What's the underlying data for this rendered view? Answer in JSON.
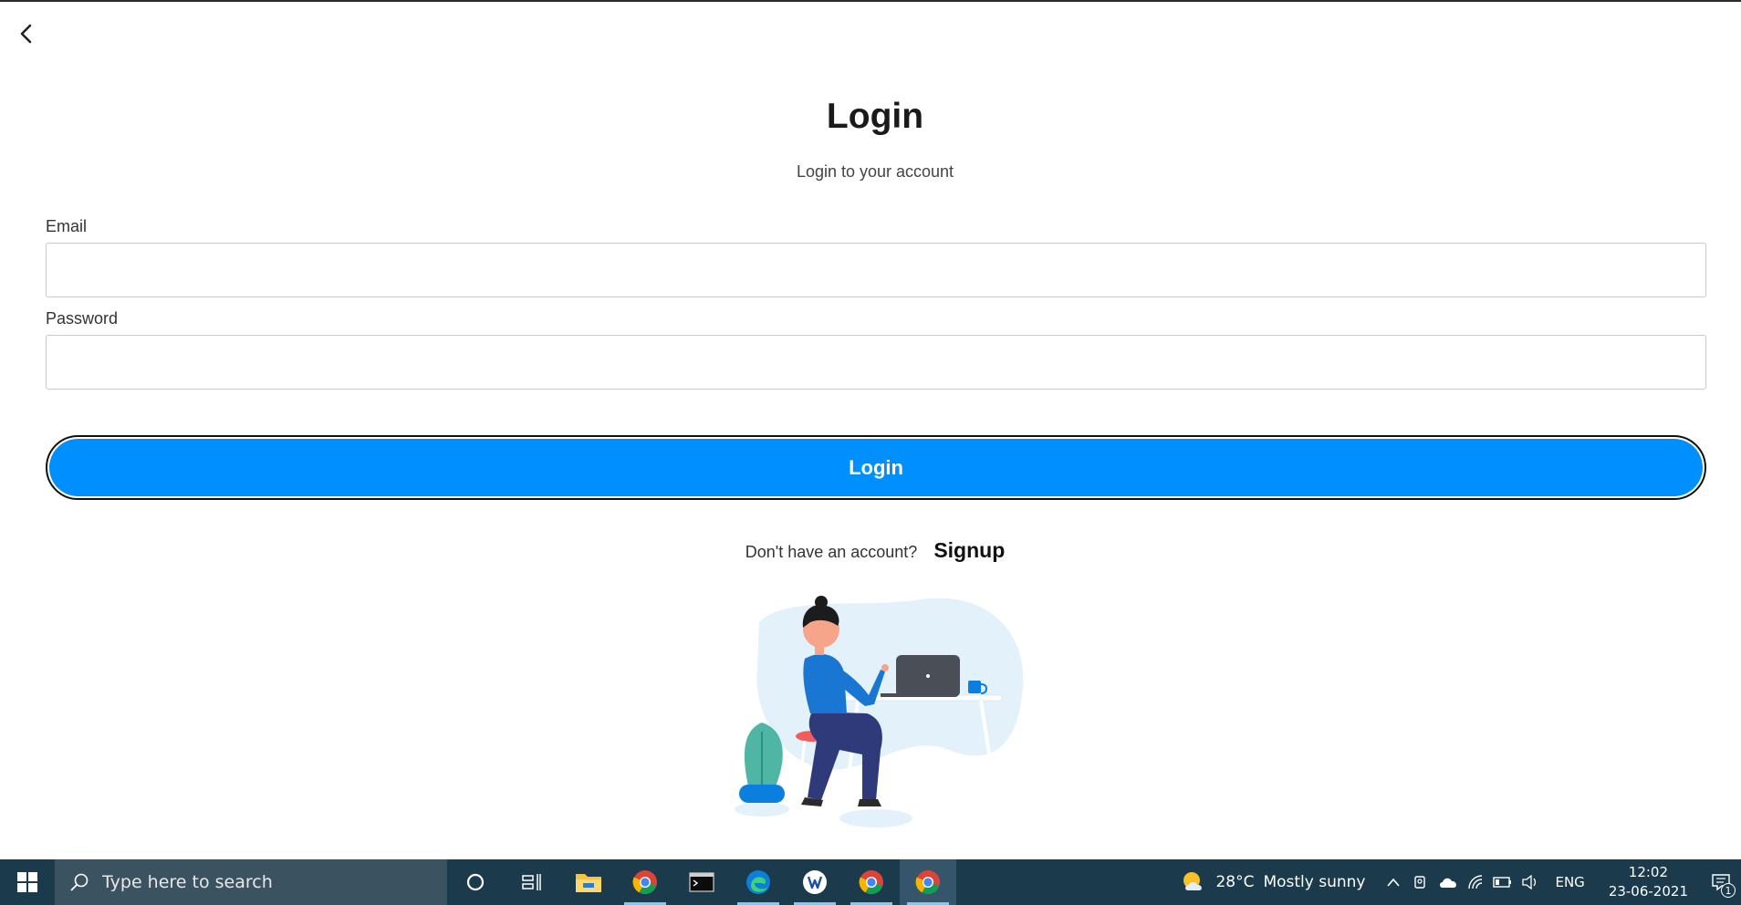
{
  "page": {
    "title": "Login",
    "subtitle": "Login to your account"
  },
  "form": {
    "email_label": "Email",
    "email_value": "",
    "password_label": "Password",
    "password_value": "",
    "login_label": "Login"
  },
  "signup": {
    "prompt": "Don't have an account?",
    "link": "Signup"
  },
  "illustration": {
    "icon": "person-at-laptop-illustration"
  },
  "taskbar": {
    "search_placeholder": "Type here to search",
    "apps": [
      "cortana-icon",
      "task-view-icon",
      "file-explorer-icon",
      "chrome-icon",
      "terminal-icon",
      "edge-icon",
      "app-icon",
      "chrome-icon",
      "chrome-icon"
    ],
    "weather": {
      "temp": "28°C",
      "condition": "Mostly sunny"
    },
    "language": "ENG",
    "time": "12:02",
    "date": "23-06-2021",
    "notification_count": "1"
  },
  "colors": {
    "primary": "#008fff",
    "taskbar": "#1b3a4b"
  }
}
